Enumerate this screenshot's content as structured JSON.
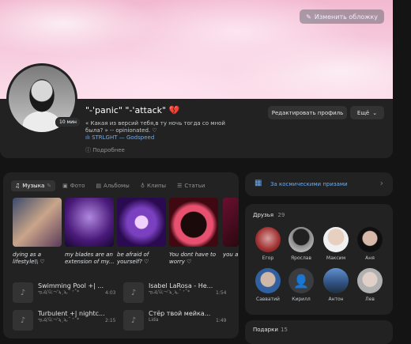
{
  "cover": {
    "edit_label": "Изменить обложку"
  },
  "profile": {
    "name": "\"-'panic\" \"-'attack\"",
    "name_emoji": "💔",
    "online_badge": "10 мин",
    "status": "« Какая из версий тебя,в ту ночь тогда со мной была? » -- opinionated. ♡",
    "music_status": "STRLGHT — Godspeed",
    "details_label": "Подробнее",
    "edit_profile_label": "Редактировать профиль",
    "more_label": "Ещё"
  },
  "tabs": [
    {
      "label": "Музыка",
      "icon": "music-note-icon"
    },
    {
      "label": "Фото",
      "icon": "photo-icon"
    },
    {
      "label": "Альбомы",
      "icon": "albums-icon"
    },
    {
      "label": "Клипы",
      "icon": "clips-icon"
    },
    {
      "label": "Статьи",
      "icon": "articles-icon"
    }
  ],
  "playlists": [
    {
      "caption": "dying as a lifestyle\\\\ ♡"
    },
    {
      "caption": "my blades are an extension of my..."
    },
    {
      "caption": "be afraid of yourself? ♡"
    },
    {
      "caption": "You dont have to worry ♡"
    },
    {
      "caption": "you a"
    }
  ],
  "tracks": [
    {
      "title": "Swimming Pool +| ...",
      "artist": "ఌ,ష'ü;¬'ϡ¸ϡ,˝ ⁺˚*",
      "duration": "4:03"
    },
    {
      "title": "Isabel LaRosa - He...",
      "artist": "ఌ,ష'ü;¬'ϡ¸ϡ,˝ ⁺˚*",
      "duration": "1:54"
    },
    {
      "title": "Turbulent +| nightc...",
      "artist": "ఌ,ష'ü;¬'ϡ¸ϡ,˝ ⁺˚*",
      "duration": "2:15"
    },
    {
      "title": "Стёр твой мейка...",
      "artist": "Lida",
      "duration": "1:49"
    }
  ],
  "promo": {
    "label": "За космическими призами"
  },
  "friends": {
    "title": "Друзья",
    "count": "29",
    "list": [
      {
        "name": "Егор"
      },
      {
        "name": "Ярослав"
      },
      {
        "name": "Максим"
      },
      {
        "name": "Аня"
      },
      {
        "name": "Савватий"
      },
      {
        "name": "Кирилл"
      },
      {
        "name": "Антон"
      },
      {
        "name": "Лев"
      }
    ]
  },
  "gifts": {
    "title": "Подарки",
    "count": "15"
  },
  "colors": {
    "accent": "#71aaeb",
    "promo_text": "#71aaeb",
    "heart": "#e64d6e"
  }
}
